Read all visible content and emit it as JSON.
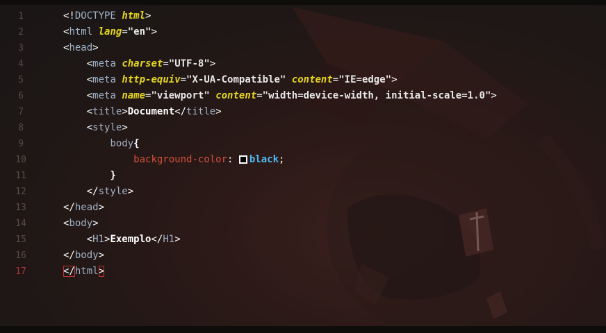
{
  "editor": {
    "line_numbers": [
      "1",
      "2",
      "3",
      "4",
      "5",
      "6",
      "7",
      "8",
      "9",
      "10",
      "11",
      "12",
      "13",
      "14",
      "15",
      "16",
      "17"
    ],
    "active_line": "17",
    "colors": {
      "background": "#1e1716",
      "tag": "#9fb3c7",
      "attribute": "#e6d51f",
      "css_property": "#d4503a",
      "css_value": "#53b8f2",
      "bracket_match": "#c63131"
    },
    "tokens": {
      "l1": {
        "open": "<!",
        "tag": "DOCTYPE",
        "attr": "html",
        "close": ">"
      },
      "l2": {
        "open": "<",
        "tag": "html",
        "attr": "lang",
        "eq": "=",
        "val": "\"en\"",
        "close": ">"
      },
      "l3": {
        "open": "<",
        "tag": "head",
        "close": ">"
      },
      "l4": {
        "open": "<",
        "tag": "meta",
        "attr": "charset",
        "eq": "=",
        "val": "\"UTF-8\"",
        "close": ">"
      },
      "l5": {
        "open": "<",
        "tag": "meta",
        "attr1": "http-equiv",
        "eq1": "=",
        "val1": "\"X-UA-Compatible\"",
        "attr2": "content",
        "eq2": "=",
        "val2": "\"IE=edge\"",
        "close": ">"
      },
      "l6": {
        "open": "<",
        "tag": "meta",
        "attr1": "name",
        "eq1": "=",
        "val1": "\"viewport\"",
        "attr2": "content",
        "eq2": "=",
        "val2": "\"width=device-width, initial-scale=1.0\"",
        "close": ">"
      },
      "l7": {
        "open": "<",
        "tag": "title",
        "close1": ">",
        "text": "Document",
        "open2": "</",
        "tag2": "title",
        "close2": ">"
      },
      "l8": {
        "open": "<",
        "tag": "style",
        "close": ">"
      },
      "l9": {
        "selector": "body",
        "brace": "{"
      },
      "l10": {
        "prop": "background-color",
        "colon": ": ",
        "value": "black",
        "semi": ";"
      },
      "l11": {
        "brace": "}"
      },
      "l12": {
        "open": "</",
        "tag": "style",
        "close": ">"
      },
      "l13": {
        "open": "</",
        "tag": "head",
        "close": ">"
      },
      "l14": {
        "open": "<",
        "tag": "body",
        "close": ">"
      },
      "l15": {
        "open": "<",
        "tag": "H1",
        "close1": ">",
        "text": "Exemplo",
        "open2": "</",
        "tag2": "H1",
        "close2": ">"
      },
      "l16": {
        "open": "</",
        "tag": "body",
        "close": ">"
      },
      "l17": {
        "open": "</",
        "tag": "html",
        "close": ">"
      }
    }
  }
}
